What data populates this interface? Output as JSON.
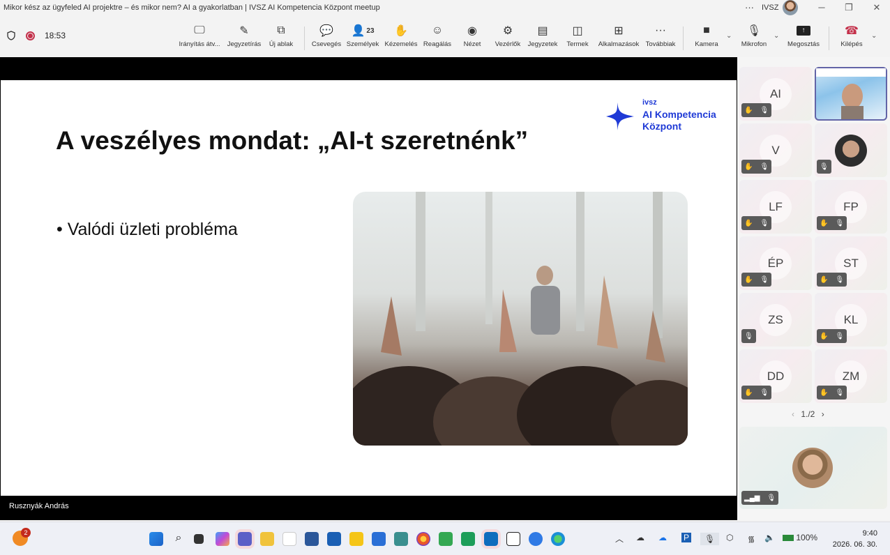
{
  "window": {
    "title": "Mikor kész az ügyfeled AI projektre – és mikor nem? AI a gyakorlatban | IVSZ AI Kompetencia Központ meetup",
    "org": "IVSZ",
    "more": "···"
  },
  "meeting": {
    "timer": "18:53",
    "people_count": "23"
  },
  "toolbar": {
    "items": [
      {
        "label": "Irányítás átv...",
        "icon": "take-control-icon"
      },
      {
        "label": "Jegyzetírás",
        "icon": "pen-icon"
      },
      {
        "label": "Új ablak",
        "icon": "new-window-icon"
      },
      {
        "label": "Csevegés",
        "icon": "chat-icon"
      },
      {
        "label": "Személyek",
        "icon": "people-icon"
      },
      {
        "label": "Kézemelés",
        "icon": "hand-icon"
      },
      {
        "label": "Reagálás",
        "icon": "smile-icon"
      },
      {
        "label": "Nézet",
        "icon": "view-icon"
      },
      {
        "label": "Vezérlők",
        "icon": "gear-icon"
      },
      {
        "label": "Jegyzetek",
        "icon": "notes-icon"
      },
      {
        "label": "Termek",
        "icon": "rooms-icon"
      },
      {
        "label": "Alkalmazások",
        "icon": "plus-icon"
      },
      {
        "label": "Továbbiak",
        "icon": "more-icon"
      },
      {
        "label": "Kamera",
        "icon": "camera-off-icon"
      },
      {
        "label": "Mikrofon",
        "icon": "mic-off-icon"
      },
      {
        "label": "Megosztás",
        "icon": "share-icon"
      },
      {
        "label": "Kilépés",
        "icon": "hangup-icon"
      }
    ]
  },
  "slide": {
    "title": "A veszélyes mondat: „AI-t szeretnénk”",
    "bullet": "Valódi üzleti probléma",
    "logo": {
      "line1": "ivsz",
      "line2": "AI Kompetencia",
      "line3": "Központ"
    }
  },
  "presenter": {
    "name": "Rusznyák András"
  },
  "participants": [
    {
      "initials": "AI"
    },
    {
      "initials": ""
    },
    {
      "initials": "V"
    },
    {
      "initials": ""
    },
    {
      "initials": "LF"
    },
    {
      "initials": "FP"
    },
    {
      "initials": "ÉP"
    },
    {
      "initials": "ST"
    },
    {
      "initials": "ZS"
    },
    {
      "initials": "KL"
    },
    {
      "initials": "DD"
    },
    {
      "initials": "ZM"
    }
  ],
  "pager": {
    "text": "1./2"
  },
  "taskbar": {
    "notification_count": "2",
    "battery": "100%",
    "time": "9:40",
    "date": "2026. 06. 30."
  },
  "colors": {
    "accent": "#1f3ad6",
    "record": "#c4314b",
    "hangup": "#c4314b"
  }
}
